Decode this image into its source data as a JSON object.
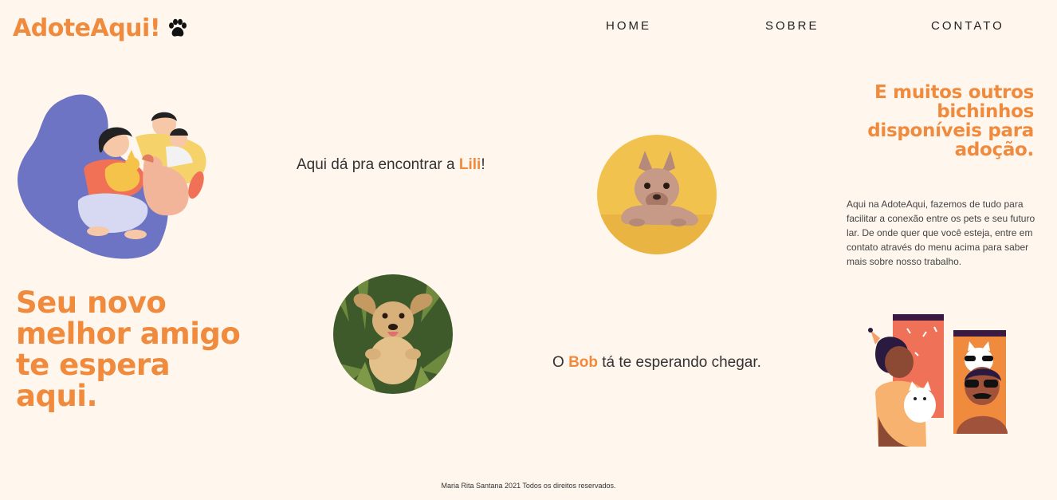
{
  "header": {
    "logo_text": "AdoteAqui!",
    "logo_icon": "paw-icon",
    "nav": {
      "home": "HOME",
      "sobre": "SOBRE",
      "contato": "CONTATO"
    }
  },
  "hero": {
    "title": "Seu novo melhor amigo te espera aqui."
  },
  "pets": {
    "lili": {
      "caption_before": "Aqui dá pra encontrar a ",
      "name": "Lili",
      "caption_after": "!"
    },
    "bob": {
      "caption_before": "O ",
      "name": "Bob",
      "caption_after": " tá te esperando chegar."
    }
  },
  "side": {
    "title": "E muitos outros bichinhos disponíveis para adoção.",
    "text": "Aqui na AdoteAqui, fazemos de tudo para facilitar a conexão entre os pets e seu futuro lar. De onde quer que você esteja, entre em contato através do menu acima para saber mais sobre nosso trabalho."
  },
  "footer": {
    "text": "Maria Rita Santana 2021 Todos os direitos reservados."
  },
  "colors": {
    "background": "#fff6ee",
    "accent": "#f08a3c",
    "illustration_blob": "#6e74c4"
  }
}
